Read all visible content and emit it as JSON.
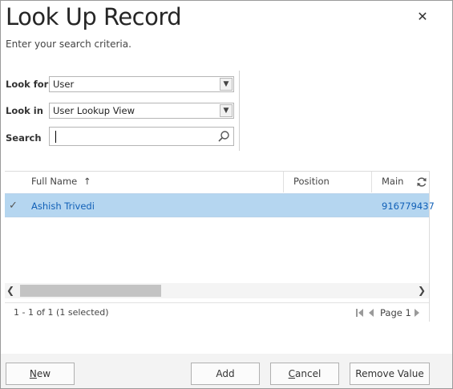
{
  "dialog": {
    "title": "Look Up Record",
    "subtitle": "Enter your search criteria.",
    "close_glyph": "✕"
  },
  "form": {
    "look_for_label": "Look for",
    "look_for_value": "User",
    "look_in_label": "Look in",
    "look_in_value": "User Lookup View",
    "search_label": "Search",
    "search_value": ""
  },
  "grid": {
    "columns": [
      {
        "label": "Full Name",
        "sort_glyph": "↑"
      },
      {
        "label": "Position"
      },
      {
        "label": "Main"
      }
    ],
    "rows": [
      {
        "full_name": "Ashish Trivedi",
        "position": "",
        "main": "916779437",
        "selected": true
      }
    ]
  },
  "footer": {
    "record_count": "1 - 1 of 1 (1 selected)",
    "page_label": "Page 1"
  },
  "buttons": {
    "new_first": "N",
    "new_rest": "ew",
    "add": "Add",
    "cancel_first": "C",
    "cancel_rest": "ancel",
    "remove_value": "Remove Value"
  },
  "icons": {
    "close": "close-icon",
    "dropdown": "chevron-down-icon",
    "search": "search-icon",
    "sort": "sort-ascending-icon",
    "refresh": "refresh-icon",
    "check": "check-icon",
    "first_page": "first-page-icon",
    "prev_page": "previous-page-icon",
    "next_page": "next-page-icon"
  },
  "colors": {
    "selected_row": "#b5d6f0",
    "link_text": "#1160b7",
    "button_bar": "#f3f3f3"
  }
}
